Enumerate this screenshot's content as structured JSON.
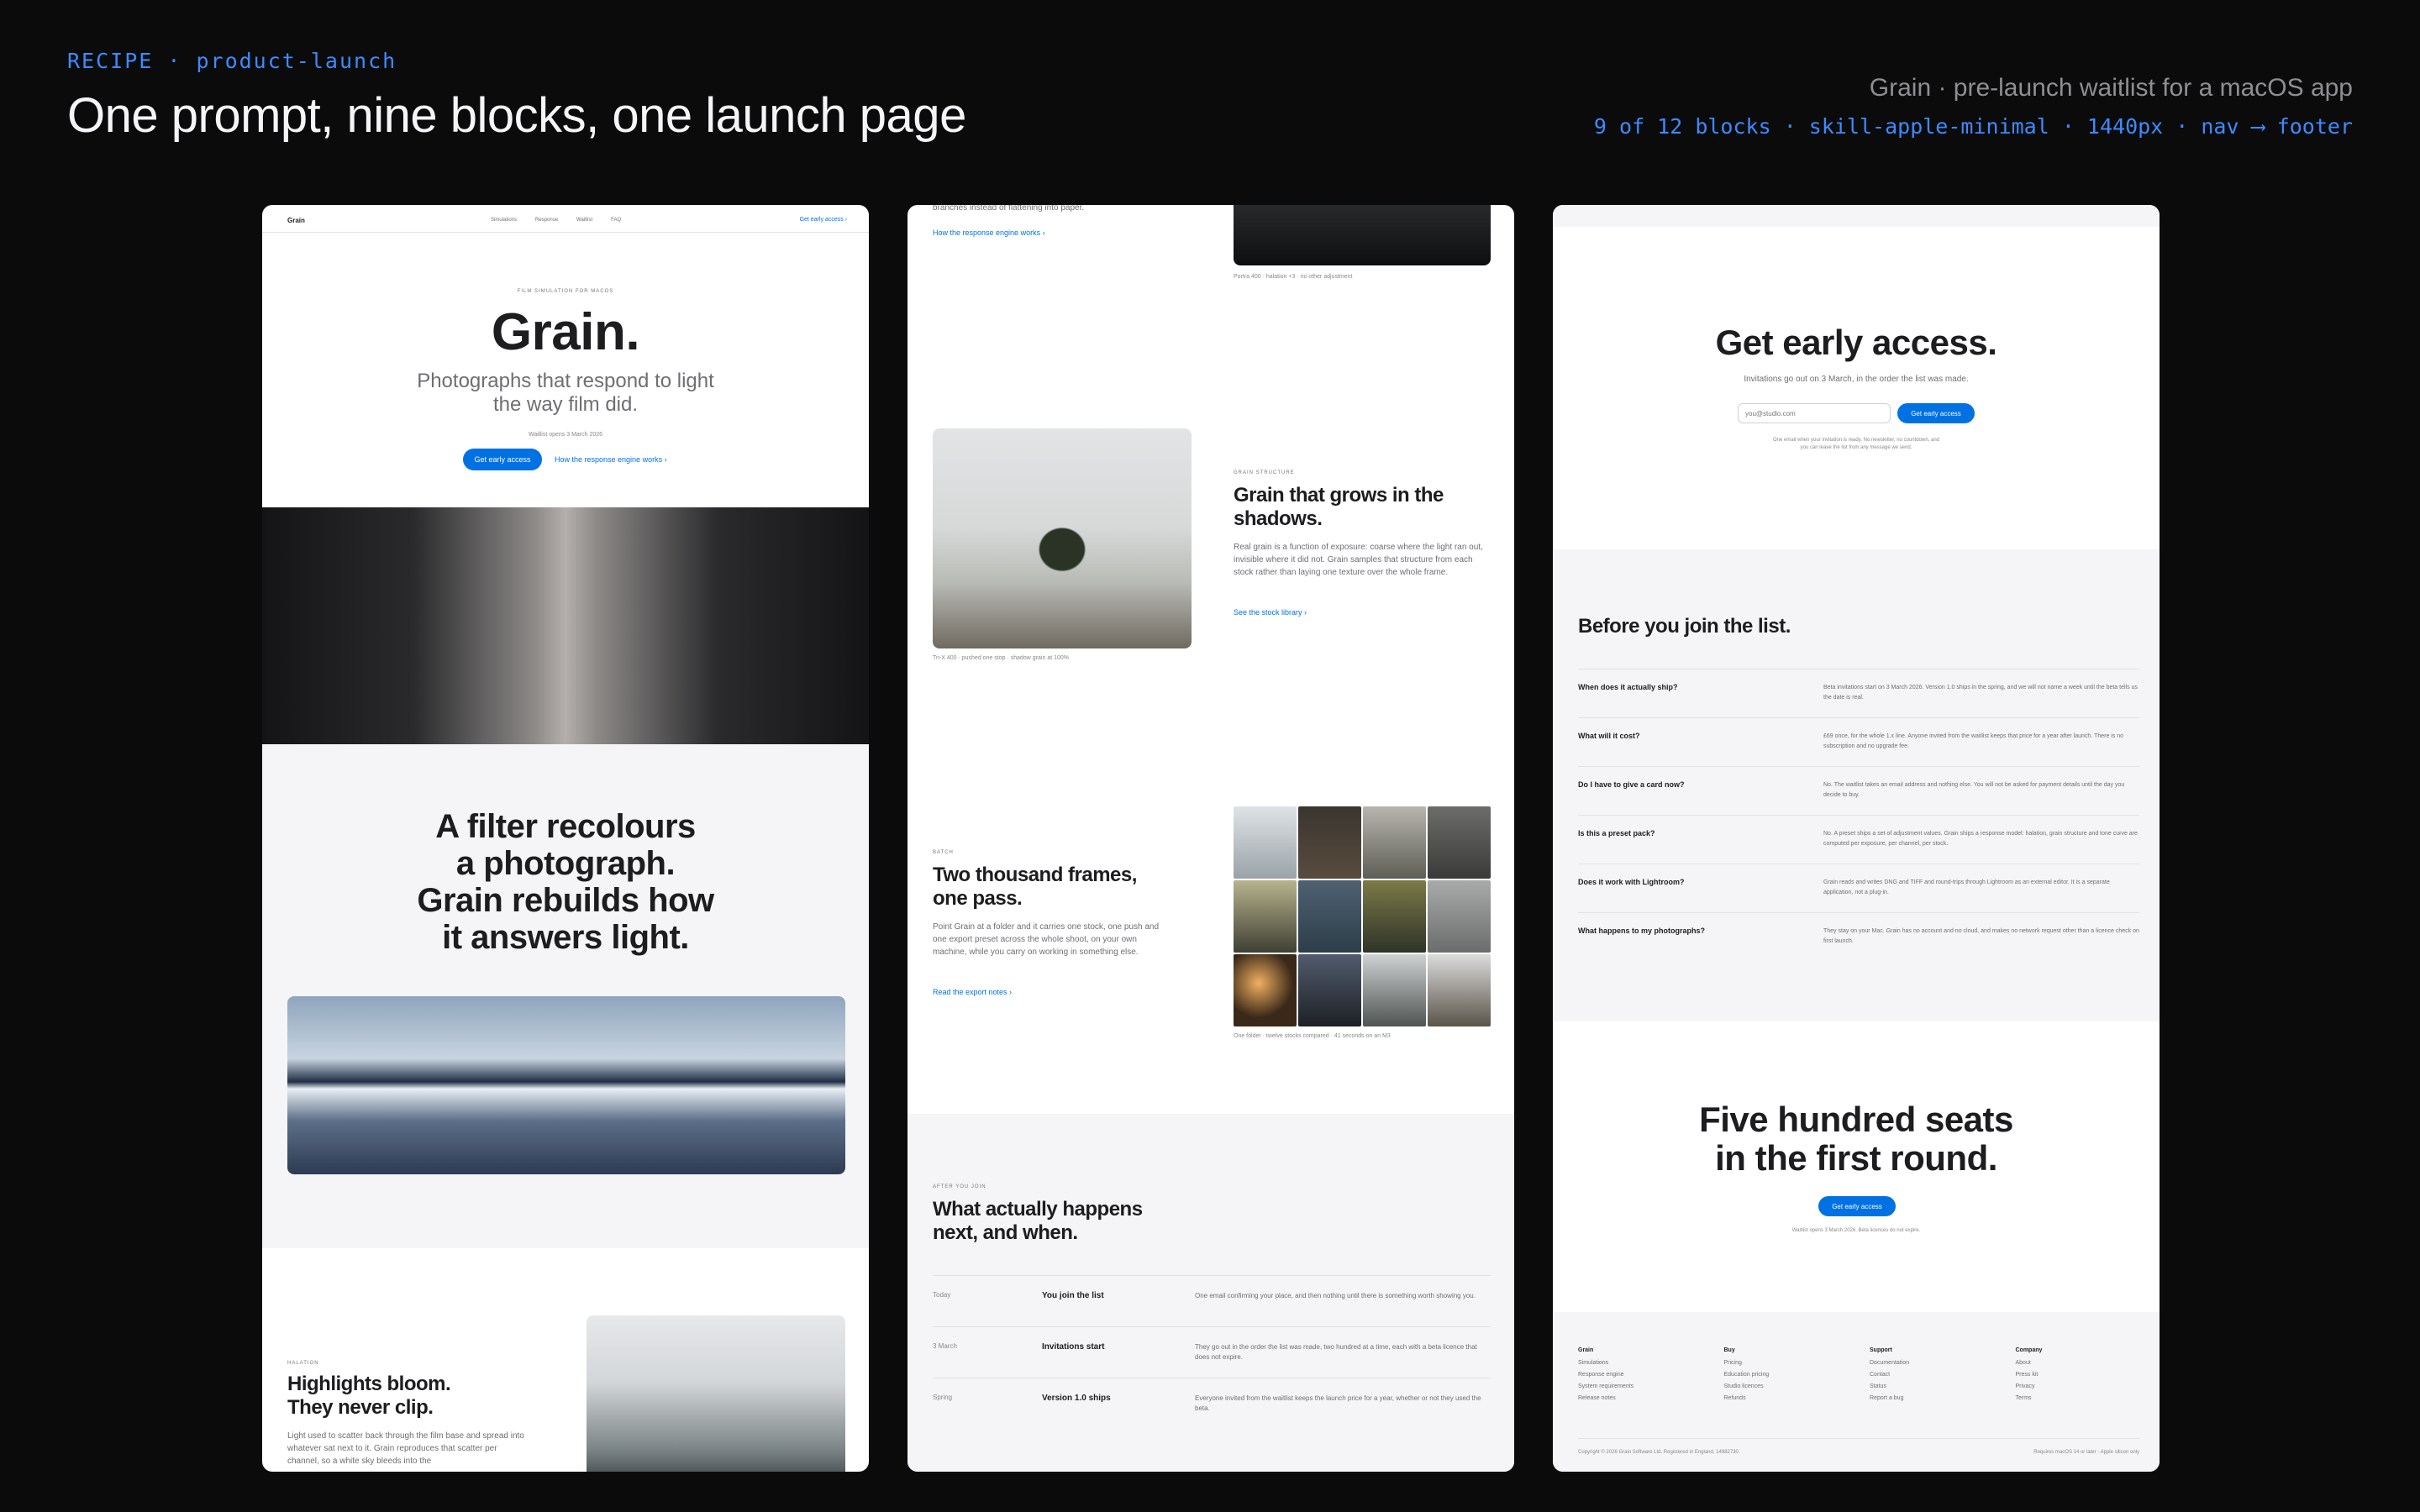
{
  "header": {
    "tag": "RECIPE · product-launch",
    "title": "One prompt, nine blocks, one launch page",
    "subtitle": "Grain · pre-launch waitlist for a macOS app",
    "meta": "9 of 12 blocks · skill-apple-minimal · 1440px · nav ⟶ footer"
  },
  "p1": {
    "nav": {
      "logo": "Grain",
      "links": [
        "Simulations",
        "Response",
        "Waitlist",
        "FAQ"
      ],
      "cta": "Get early access ›"
    },
    "hero": {
      "eyebrow": "FILM SIMULATION FOR MACOS",
      "title": "Grain.",
      "tagline_1": "Photographs that respond to light",
      "tagline_2": "the way film did.",
      "note": "Waitlist opens 3 March 2026",
      "cta": "Get early access",
      "link": "How the response engine works ›"
    },
    "statement": {
      "l1": "A filter recolours",
      "l2": "a photograph.",
      "l3": "Grain rebuilds how",
      "l4": "it answers light."
    },
    "feature": {
      "eyebrow": "HALATION",
      "t1": "Highlights bloom.",
      "t2": "They never clip.",
      "body": "Light used to scatter back through the film base and spread into whatever sat next to it. Grain reproduces that scatter per channel, so a white sky bleeds into the"
    }
  },
  "p2": {
    "top": {
      "body": "branches instead of flattening into paper.",
      "link": "How the response engine works ›",
      "caption": "Portra 400 · halation +3 · no other adjustment"
    },
    "structure": {
      "eyebrow": "GRAIN STRUCTURE",
      "t1": "Grain that grows in the",
      "t2": "shadows.",
      "body": "Real grain is a function of exposure: coarse where the light ran out, invisible where it did not. Grain samples that structure from each stock rather than laying one texture over the whole frame.",
      "link": "See the stock library ›",
      "caption": "Tri-X 400 · pushed one stop · shadow grain at 100%"
    },
    "batch": {
      "eyebrow": "BATCH",
      "t1": "Two thousand frames,",
      "t2": "one pass.",
      "body": "Point Grain at a folder and it carries one stock, one push and one export preset across the whole shoot, on your own machine, while you carry on working in something else.",
      "link": "Read the export notes ›",
      "caption": "One folder · twelve stocks compared · 41 seconds on an M3"
    },
    "timeline": {
      "eyebrow": "AFTER YOU JOIN",
      "t1": "What actually happens",
      "t2": "next, and when.",
      "rows": [
        {
          "when": "Today",
          "what": "You join the list",
          "desc": "One email confirming your place, and then nothing until there is something worth showing you."
        },
        {
          "when": "3 March",
          "what": "Invitations start",
          "desc": "They go out in the order the list was made, two hundred at a time, each with a beta licence that does not expire."
        },
        {
          "when": "Spring",
          "what": "Version 1.0 ships",
          "desc": "Everyone invited from the waitlist keeps the launch price for a year, whether or not they used the beta."
        }
      ]
    }
  },
  "p3": {
    "signup": {
      "title": "Get early access.",
      "sub": "Invitations go out on 3 March, in the order the list was made.",
      "placeholder": "you@studio.com",
      "cta": "Get early access",
      "fine_1": "One email when your invitation is ready. No newsletter, no countdown, and",
      "fine_2": "you can leave the list from any message we send."
    },
    "faq": {
      "title": "Before you join the list.",
      "items": [
        {
          "q": "When does it actually ship?",
          "a": "Beta invitations start on 3 March 2026. Version 1.0 ships in the spring, and we will not name a week until the beta tells us the date is real."
        },
        {
          "q": "What will it cost?",
          "a": "£69 once, for the whole 1.x line. Anyone invited from the waitlist keeps that price for a year after launch. There is no subscription and no upgrade fee."
        },
        {
          "q": "Do I have to give a card now?",
          "a": "No. The waitlist takes an email address and nothing else. You will not be asked for payment details until the day you decide to buy."
        },
        {
          "q": "Is this a preset pack?",
          "a": "No. A preset ships a set of adjustment values. Grain ships a response model: halation, grain structure and tone curve are computed per exposure, per channel, per stock."
        },
        {
          "q": "Does it work with Lightroom?",
          "a": "Grain reads and writes DNG and TIFF and round-trips through Lightroom as an external editor. It is a separate application, not a plug-in."
        },
        {
          "q": "What happens to my photographs?",
          "a": "They stay on your Mac. Grain has no account and no cloud, and makes no network request other than a licence check on first launch."
        }
      ]
    },
    "cta": {
      "t1": "Five hundred seats",
      "t2": "in the first round.",
      "button": "Get early access",
      "note": "Waitlist opens 3 March 2026. Beta licences do not expire."
    },
    "footer": {
      "cols": [
        {
          "title": "Grain",
          "items": [
            "Simulations",
            "Response engine",
            "System requirements",
            "Release notes"
          ]
        },
        {
          "title": "Buy",
          "items": [
            "Pricing",
            "Education pricing",
            "Studio licences",
            "Refunds"
          ]
        },
        {
          "title": "Support",
          "items": [
            "Documentation",
            "Contact",
            "Status",
            "Report a bug"
          ]
        },
        {
          "title": "Company",
          "items": [
            "About",
            "Press kit",
            "Privacy",
            "Terms"
          ]
        }
      ],
      "copyright": "Copyright © 2026 Grain Software Ltd. Registered in England, 14982730.",
      "req": "Requires macOS 14 or later · Apple silicon only"
    }
  }
}
